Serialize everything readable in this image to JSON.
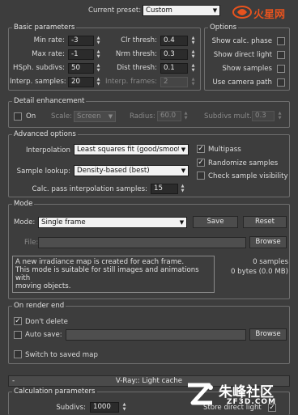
{
  "top": {
    "preset_label": "Current preset:",
    "preset_value": "Custom"
  },
  "basic": {
    "title": "Basic parameters",
    "rows_left": [
      {
        "label": "Min rate:",
        "value": "-3"
      },
      {
        "label": "Max rate:",
        "value": "-1"
      },
      {
        "label": "HSph. subdivs:",
        "value": "50"
      },
      {
        "label": "Interp. samples:",
        "value": "20"
      }
    ],
    "rows_right": [
      {
        "label": "Clr thresh:",
        "value": "0.4",
        "enabled": true
      },
      {
        "label": "Nrm thresh:",
        "value": "0.3",
        "enabled": true
      },
      {
        "label": "Dist thresh:",
        "value": "0.1",
        "enabled": true
      },
      {
        "label": "Interp. frames:",
        "value": "2",
        "enabled": false
      }
    ]
  },
  "options": {
    "title": "Options",
    "items": [
      {
        "label": "Show calc. phase",
        "checked": false
      },
      {
        "label": "Show direct light",
        "checked": false
      },
      {
        "label": "Show samples",
        "checked": false
      },
      {
        "label": "Use camera path",
        "checked": false
      }
    ]
  },
  "detail": {
    "title": "Detail enhancement",
    "on_label": "On",
    "scale_label": "Scale:",
    "scale_value": "Screen",
    "radius_label": "Radius:",
    "radius_value": "60.0",
    "subdivs_label": "Subdivs mult.",
    "subdivs_value": "0.3"
  },
  "advanced": {
    "title": "Advanced options",
    "interp_label": "Interpolation",
    "interp_value": "Least squares fit (good/smooth",
    "lookup_label": "Sample lookup:",
    "lookup_value": "Density-based (best)",
    "calc_label": "Calc. pass interpolation samples:",
    "calc_value": "15",
    "checks": [
      {
        "label": "Multipass",
        "checked": true
      },
      {
        "label": "Randomize samples",
        "checked": true
      },
      {
        "label": "Check sample visibility",
        "checked": false
      }
    ]
  },
  "mode": {
    "title": "Mode",
    "mode_label": "Mode:",
    "mode_value": "Single frame",
    "save_label": "Save",
    "reset_label": "Reset",
    "file_label": "File:",
    "browse_label": "Browse",
    "description": "A new irradiance map is created for each frame.\nThis mode is suitable for still images and animations with\nmoving objects.",
    "samples_text": "0 samples",
    "bytes_text": "0 bytes (0.0 MB)"
  },
  "render_end": {
    "title": "On render end",
    "dont_delete_label": "Don't delete",
    "dont_delete_checked": true,
    "auto_save_label": "Auto save:",
    "auto_save_checked": false,
    "browse_label": "Browse",
    "switch_label": "Switch to saved map",
    "switch_checked": false
  },
  "light_cache": {
    "rollout_title": "V-Ray:: Light cache",
    "calc_title": "Calculation parameters",
    "subdivs_label": "Subdivs:",
    "subdivs_value": "1000",
    "store_label": "Store direct light",
    "store_checked": true
  },
  "watermarks": {
    "top_text": "火星网",
    "bottom_text": "朱峰社区",
    "bottom_url": "ZF3D.COM"
  },
  "colors": {
    "panel_bg": "#3d3d3d",
    "watermark_orange": "#e8531e"
  }
}
